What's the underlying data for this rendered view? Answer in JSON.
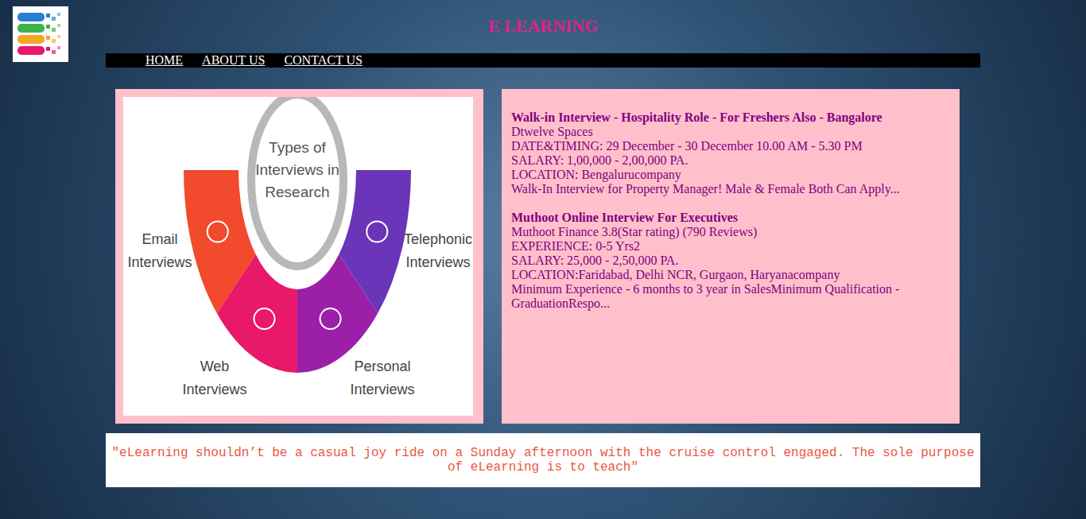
{
  "header": {
    "title": "E LEARNING"
  },
  "nav": {
    "items": [
      "HOME",
      "ABOUT US",
      "CONTACT US"
    ]
  },
  "diagram": {
    "title": [
      "Types of",
      "Interviews in",
      "Research"
    ],
    "segments": [
      {
        "label": [
          "Email",
          "Interviews"
        ],
        "color": "#f24a2c"
      },
      {
        "label": [
          "Web",
          "Interviews"
        ],
        "color": "#e8196a"
      },
      {
        "label": [
          "Personal",
          "Interviews"
        ],
        "color": "#9c1fa8"
      },
      {
        "label": [
          "Telephonic",
          "Interviews"
        ],
        "color": "#6a35b8"
      }
    ]
  },
  "jobs": [
    {
      "title": "Walk-in Interview - Hospitality Role - For Freshers Also - Bangalore",
      "lines": [
        "Dtwelve Spaces",
        "DATE&TIMING: 29 December - 30 December 10.00 AM - 5.30 PM",
        "SALARY: 1,00,000 - 2,00,000 PA.",
        "LOCATION: Bengalurucompany",
        "Walk-In Interview for Property Manager! Male & Female Both Can Apply..."
      ]
    },
    {
      "title": "Muthoot Online Interview For Executives",
      "lines": [
        "Muthoot Finance 3.8(Star rating) (790 Reviews)",
        "EXPERIENCE: 0-5 Yrs2",
        "SALARY: 25,000 - 2,50,000 PA.",
        "LOCATION:Faridabad, Delhi NCR, Gurgaon, Haryanacompany",
        "Minimum Experience - 6 months to 3 year in SalesMinimum Qualification - GraduationRespo..."
      ]
    }
  ],
  "quote": "\"eLearning shouldn’t be a casual joy ride on a Sunday afternoon with the cruise control engaged. The sole purpose of eLearning is to teach\""
}
